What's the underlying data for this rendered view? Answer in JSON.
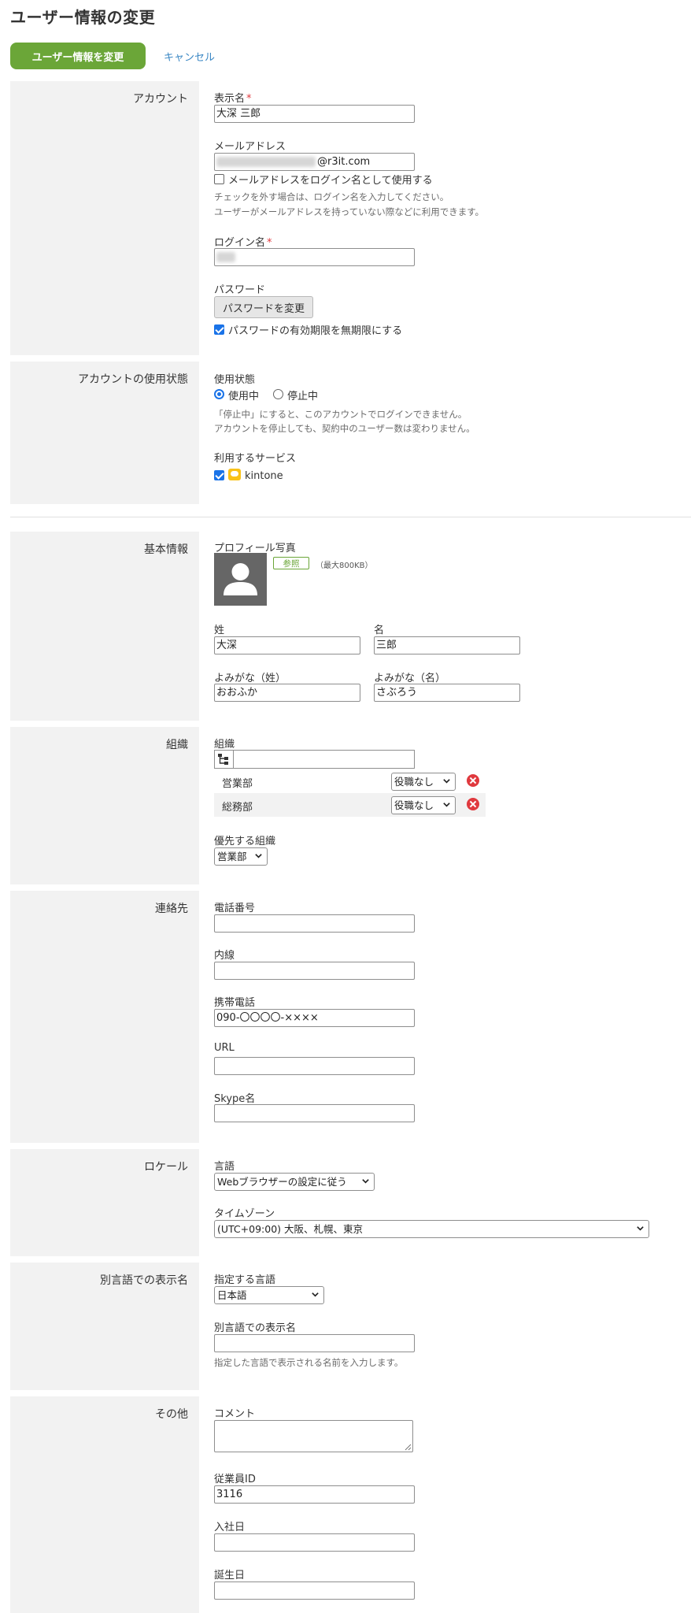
{
  "page": {
    "title": "ユーザー情報の変更"
  },
  "actions": {
    "submit_label": "ユーザー情報を変更",
    "cancel_label": "キャンセル"
  },
  "account": {
    "section_label": "アカウント",
    "display_name": {
      "label": "表示名",
      "required_mark": "*",
      "value": "大深 三郎"
    },
    "email": {
      "label": "メールアドレス",
      "value_suffix": "@r3it.com",
      "use_as_login_label": "メールアドレスをログイン名として使用する",
      "use_as_login_checked": false,
      "help_line1": "チェックを外す場合は、ログイン名を入力してください。",
      "help_line2": "ユーザーがメールアドレスを持っていない際などに利用できます。"
    },
    "login_name": {
      "label": "ログイン名",
      "required_mark": "*"
    },
    "password": {
      "label": "パスワード",
      "change_button": "パスワードを変更",
      "no_expiry_label": "パスワードの有効期限を無期限にする",
      "no_expiry_checked": true
    }
  },
  "usage": {
    "section_label": "アカウントの使用状態",
    "status_label": "使用状態",
    "active_label": "使用中",
    "suspended_label": "停止中",
    "selected": "使用中",
    "help_line1": "「停止中」にすると、このアカウントでログインできません。",
    "help_line2": "アカウントを停止しても、契約中のユーザー数は変わりません。",
    "services_label": "利用するサービス",
    "service_name": "kintone",
    "service_checked": true
  },
  "basic": {
    "section_label": "基本情報",
    "photo_label": "プロフィール写真",
    "browse_button": "参照",
    "size_note": "（最大800KB）",
    "last_name_label": "姓",
    "last_name_value": "大深",
    "first_name_label": "名",
    "first_name_value": "三郎",
    "last_kana_label": "よみがな（姓）",
    "last_kana_value": "おおふか",
    "first_kana_label": "よみがな（名）",
    "first_kana_value": "さぶろう"
  },
  "org": {
    "section_label": "組織",
    "label": "組織",
    "rows": [
      {
        "name": "営業部",
        "role": "役職なし"
      },
      {
        "name": "総務部",
        "role": "役職なし"
      }
    ],
    "priority_label": "優先する組織",
    "priority_value": "営業部"
  },
  "contact": {
    "section_label": "連絡先",
    "phone_label": "電話番号",
    "phone_value": "",
    "ext_label": "内線",
    "ext_value": "",
    "mobile_label": "携帯電話",
    "mobile_value": "090-〇〇〇〇-××××",
    "url_label": "URL",
    "url_value": "",
    "skype_label": "Skype名",
    "skype_value": ""
  },
  "locale": {
    "section_label": "ロケール",
    "language_label": "言語",
    "language_value": "Webブラウザーの設定に従う",
    "timezone_label": "タイムゾーン",
    "timezone_value": "(UTC+09:00) 大阪、札幌、東京"
  },
  "alt_name": {
    "section_label": "別言語での表示名",
    "language_label": "指定する言語",
    "language_value": "日本語",
    "name_label": "別言語での表示名",
    "name_value": "",
    "help": "指定した言語で表示される名前を入力します。"
  },
  "other": {
    "section_label": "その他",
    "comment_label": "コメント",
    "comment_value": "",
    "employee_id_label": "従業員ID",
    "employee_id_value": "3116",
    "join_date_label": "入社日",
    "join_date_value": "",
    "birthday_label": "誕生日",
    "birthday_value": ""
  },
  "colors": {
    "primary": "#6ba638",
    "link": "#3a87c4",
    "required": "#e0393e",
    "checkbox": "#1a73e8",
    "section_bg": "#f2f2f2"
  }
}
